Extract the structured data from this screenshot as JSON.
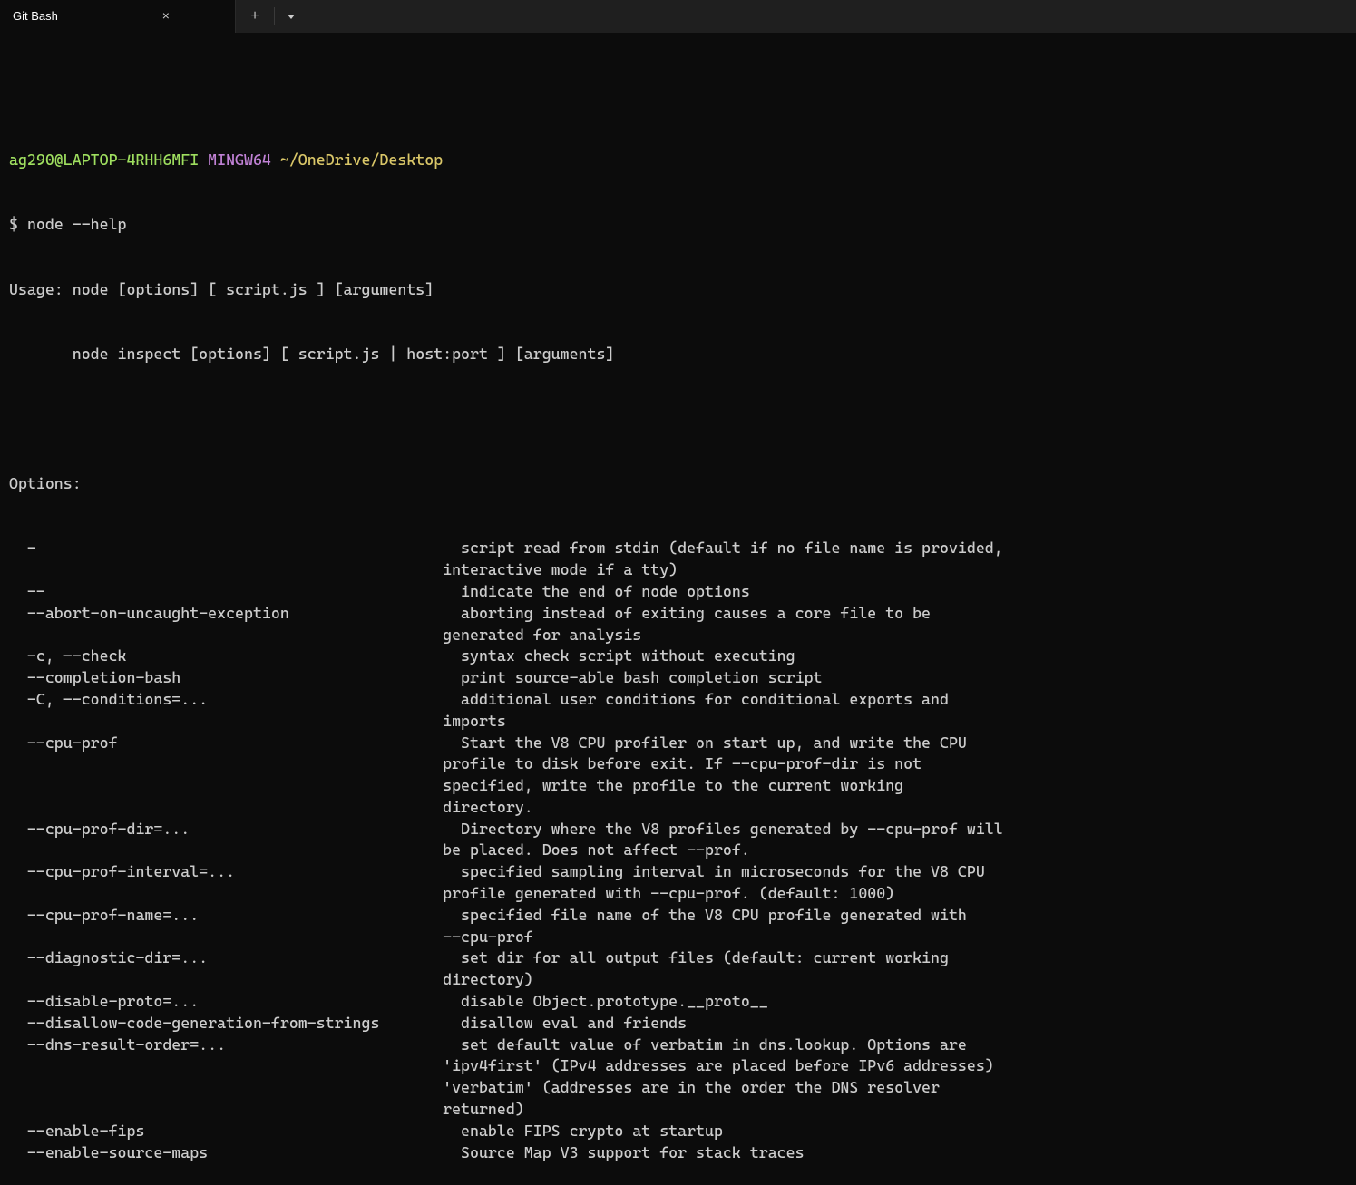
{
  "titlebar": {
    "tab_title": "Git Bash",
    "close_glyph": "×",
    "add_glyph": "+"
  },
  "prompt": {
    "user_host": "ag290@LAPTOP-4RHH6MFI",
    "env": "MINGW64",
    "cwd": "~/OneDrive/Desktop",
    "symbol": "$",
    "command": "node --help"
  },
  "usage": {
    "line1": "Usage: node [options] [ script.js ] [arguments]",
    "line2": "       node inspect [options] [ script.js | host:port ] [arguments]"
  },
  "options_header": "Options:",
  "options": [
    {
      "flag": "-",
      "desc": "script read from stdin (default if no file name is provided,",
      "cont": [
        "interactive mode if a tty)"
      ]
    },
    {
      "flag": "--",
      "desc": "indicate the end of node options"
    },
    {
      "flag": "--abort-on-uncaught-exception",
      "desc": "aborting instead of exiting causes a core file to be",
      "cont": [
        "generated for analysis"
      ]
    },
    {
      "flag": "-c, --check",
      "desc": "syntax check script without executing"
    },
    {
      "flag": "--completion-bash",
      "desc": "print source-able bash completion script"
    },
    {
      "flag": "-C, --conditions=...",
      "desc": "additional user conditions for conditional exports and",
      "cont": [
        "imports"
      ]
    },
    {
      "flag": "--cpu-prof",
      "desc": "Start the V8 CPU profiler on start up, and write the CPU",
      "cont": [
        "profile to disk before exit. If --cpu-prof-dir is not",
        "specified, write the profile to the current working",
        "directory."
      ]
    },
    {
      "flag": "--cpu-prof-dir=...",
      "desc": "Directory where the V8 profiles generated by --cpu-prof will",
      "cont": [
        "be placed. Does not affect --prof."
      ]
    },
    {
      "flag": "--cpu-prof-interval=...",
      "desc": "specified sampling interval in microseconds for the V8 CPU",
      "cont": [
        "profile generated with --cpu-prof. (default: 1000)"
      ]
    },
    {
      "flag": "--cpu-prof-name=...",
      "desc": "specified file name of the V8 CPU profile generated with",
      "cont": [
        "--cpu-prof"
      ]
    },
    {
      "flag": "--diagnostic-dir=...",
      "desc": "set dir for all output files (default: current working",
      "cont": [
        "directory)"
      ]
    },
    {
      "flag": "--disable-proto=...",
      "desc": "disable Object.prototype.__proto__"
    },
    {
      "flag": "--disallow-code-generation-from-strings",
      "desc": "disallow eval and friends"
    },
    {
      "flag": "--dns-result-order=...",
      "desc": "set default value of verbatim in dns.lookup. Options are",
      "cont": [
        "'ipv4first' (IPv4 addresses are placed before IPv6 addresses)",
        "'verbatim' (addresses are in the order the DNS resolver",
        "returned)"
      ]
    },
    {
      "flag": "--enable-fips",
      "desc": "enable FIPS crypto at startup"
    },
    {
      "flag": "--enable-source-maps",
      "desc": "Source Map V3 support for stack traces"
    }
  ]
}
